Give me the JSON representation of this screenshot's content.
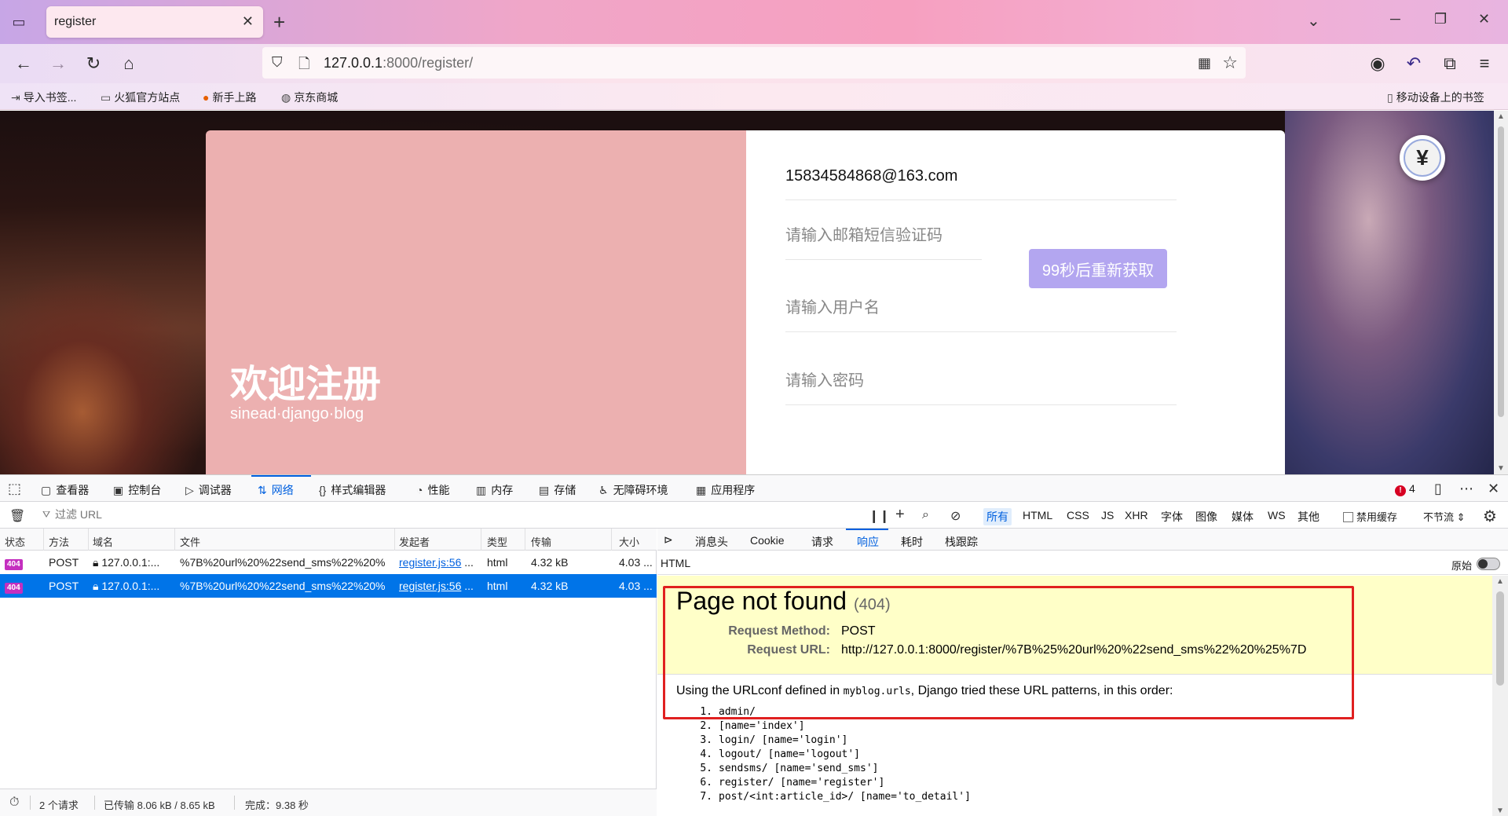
{
  "browser": {
    "tab_title": "register",
    "tab_close": "✕",
    "new_tab": "+",
    "url_host": "127.0.0.1",
    "url_rest": ":8000/register/",
    "icons": [
      "tab-list-icon",
      "back-icon",
      "forward-icon",
      "reload-icon",
      "home-icon",
      "shield-icon",
      "page-icon",
      "qr-code-icon",
      "star-icon",
      "account-icon",
      "undo-icon",
      "extensions-icon",
      "menu-icon",
      "minimize-icon",
      "restore-icon",
      "close-icon"
    ]
  },
  "bookmarks": {
    "import": "导入书签...",
    "firefox_sites": "火狐官方站点",
    "getting_started": "新手上路",
    "jd": "京东商城",
    "mobile": "移动设备上的书签"
  },
  "page": {
    "welcome": "欢迎注册",
    "subtitle": "sinead·django·blog",
    "email_value": "15834584868@163.com",
    "code_placeholder": "请输入邮箱短信验证码",
    "resend_label": "99秒后重新获取",
    "username_placeholder": "请输入用户名",
    "password_placeholder": "请输入密码",
    "colors": {
      "card_left": "#ecb0b0",
      "resend_button": "#b3a6f0"
    }
  },
  "devtools": {
    "tabs": [
      "查看器",
      "控制台",
      "调试器",
      "网络",
      "样式编辑器",
      "性能",
      "内存",
      "存储",
      "无障碍环境",
      "应用程序"
    ],
    "active_tab": "网络",
    "error_count": "4",
    "filter_placeholder": "过滤 URL",
    "type_filters": [
      "所有",
      "HTML",
      "CSS",
      "JS",
      "XHR",
      "字体",
      "图像",
      "媒体",
      "WS",
      "其他"
    ],
    "disable_cache": "禁用缓存",
    "throttle": "不节流 ⇕",
    "columns": [
      "状态",
      "方法",
      "域名",
      "文件",
      "发起者",
      "类型",
      "传输",
      "大小"
    ],
    "requests": [
      {
        "status": "404",
        "method": "POST",
        "domain": "127.0.0.1:...",
        "file": "%7B%20url%20%22send_sms%22%20%",
        "initiator": "register.js:56",
        "initiator_rest": " ...",
        "type": "html",
        "transferred": "4.32 kB",
        "size": "4.03 ..."
      },
      {
        "status": "404",
        "method": "POST",
        "domain": "127.0.0.1:...",
        "file": "%7B%20url%20%22send_sms%22%20%",
        "initiator": "register.js:56",
        "initiator_rest": " ...",
        "type": "html",
        "transferred": "4.32 kB",
        "size": "4.03 ..."
      }
    ],
    "status_bar": {
      "requests": "2 个请求",
      "transferred": "已传输 8.06 kB / 8.65 kB",
      "finish": "完成：9.38 秒"
    },
    "detail_tabs": [
      "消息头",
      "Cookie",
      "请求",
      "响应",
      "耗时",
      "栈跟踪"
    ],
    "detail_active": "响应",
    "detail_format": "HTML",
    "raw_label": "原始",
    "response": {
      "title": "Page not found",
      "code": "(404)",
      "method_key": "Request Method:",
      "method_val": "POST",
      "url_key": "Request URL:",
      "url_val": "http://127.0.0.1:8000/register/%7B%25%20url%20%22send_sms%22%20%25%7D",
      "info_pre": "Using the URLconf defined in ",
      "info_mono": "myblog.urls",
      "info_post": ", Django tried these URL patterns, in this order:",
      "patterns": [
        "admin/",
        "[name='index']",
        "login/ [name='login']",
        "logout/ [name='logout']",
        "sendsms/ [name='send_sms']",
        "register/ [name='register']",
        "post/<int:article_id>/ [name='to_detail']"
      ]
    },
    "highlight_color": "#e02020"
  }
}
